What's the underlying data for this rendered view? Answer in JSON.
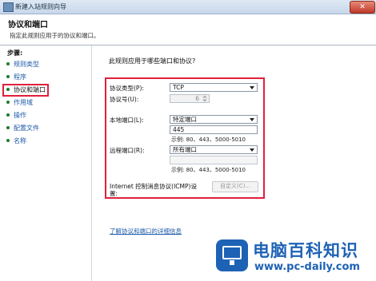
{
  "window": {
    "title": "新建入站规则向导",
    "close_glyph": "✕"
  },
  "header": {
    "title": "协议和端口",
    "subtitle": "指定此规则应用于的协议和端口。"
  },
  "sidebar": {
    "steps_label": "步骤:",
    "items": [
      {
        "label": "规则类型"
      },
      {
        "label": "程序"
      },
      {
        "label": "协议和端口"
      },
      {
        "label": "作用域"
      },
      {
        "label": "操作"
      },
      {
        "label": "配置文件"
      },
      {
        "label": "名称"
      }
    ],
    "current_index": 2
  },
  "main": {
    "question": "此规则应用于哪些端口和协议?",
    "protocol_type": {
      "label": "协议类型(P):",
      "value": "TCP"
    },
    "protocol_number": {
      "label": "协议号(U):",
      "value": "6"
    },
    "local_port": {
      "label": "本地端口(L):",
      "value": "特定端口",
      "input": "445",
      "example": "示例: 80、443、5000-5010"
    },
    "remote_port": {
      "label": "远程端口(R):",
      "value": "所有端口",
      "input": "",
      "example": "示例: 80、443、5000-5010"
    },
    "icmp": {
      "label_line1": "Internet 控制消息协议(ICMP)设",
      "label_line2": "置:",
      "button": "自定义(C)..."
    },
    "link": "了解协议和端口的详细信息"
  },
  "watermark": {
    "cn": "电脑百科知识",
    "url": "www.pc-daily.com"
  },
  "colors": {
    "highlight_border": "#e0203a",
    "link": "#1e5aa8",
    "watermark": "#1d62b5"
  }
}
